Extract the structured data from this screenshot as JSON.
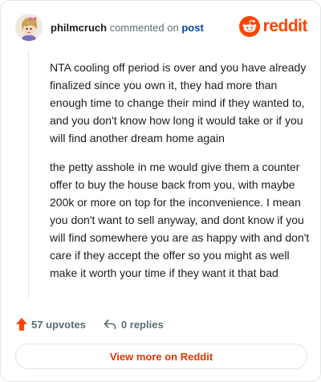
{
  "comment": {
    "username": "philmcruch",
    "action_text": "commented on",
    "post_link": "post",
    "paragraphs": [
      "NTA cooling off period is over and you have already finalized since you own it, they had more than enough time to change their mind if they wanted to, and you don't know how long it would take or if you will find another dream home again",
      "the petty asshole in me would give them a counter offer to buy the house back from you, with maybe 200k or more on top for the inconvenience. I mean you don't want to sell anyway, and dont know if you will find somewhere you are as happy with and don't care if they accept the offer so you might as well make it worth your time if they want it that bad"
    ]
  },
  "brand": {
    "wordmark": "reddit",
    "color": "#ff4500"
  },
  "stats": {
    "upvotes_label": "57 upvotes",
    "replies_label": "0 replies"
  },
  "footer": {
    "view_more_label": "View more on Reddit"
  },
  "icons": {
    "avatar": "avatar-icon",
    "logo": "reddit-snoo-icon",
    "upvote": "upvote-arrow-icon",
    "reply": "reply-arrow-icon"
  },
  "colors": {
    "upvote": "#ff4500",
    "link": "#0045ac",
    "button_text": "#d93a00"
  }
}
